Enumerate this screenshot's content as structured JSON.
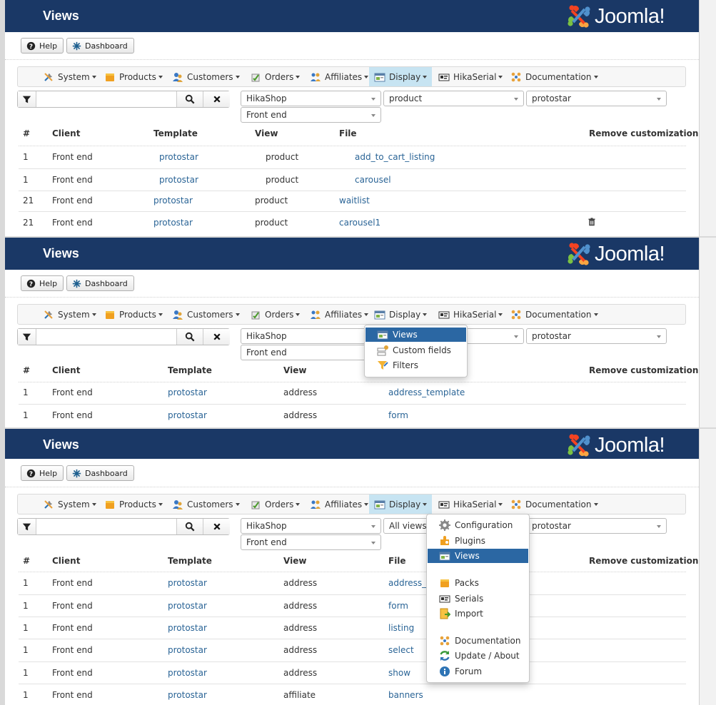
{
  "header": {
    "title": "Views",
    "logo_text": "Joomla!"
  },
  "toolbar": {
    "help_label": "Help",
    "dashboard_label": "Dashboard"
  },
  "menu": {
    "system": "System",
    "products": "Products",
    "customers": "Customers",
    "orders": "Orders",
    "affiliates": "Affiliates",
    "display": "Display",
    "hikaserial": "HikaSerial",
    "documentation": "Documentation"
  },
  "display_dropdown": {
    "views": "Views",
    "custom_fields": "Custom fields",
    "filters": "Filters"
  },
  "hikaserial_dropdown": {
    "configuration": "Configuration",
    "plugins": "Plugins",
    "views": "Views",
    "packs": "Packs",
    "serials": "Serials",
    "import": "Import",
    "documentation": "Documentation",
    "update_about": "Update / About",
    "forum": "Forum"
  },
  "table_headers": {
    "num": "#",
    "client": "Client",
    "template": "Template",
    "view": "View",
    "file": "File",
    "remove": "Remove customization"
  },
  "panel1": {
    "filters": {
      "component": "HikaShop",
      "view": "product",
      "template": "protostar",
      "client": "Front end"
    },
    "rows": [
      {
        "num": "1",
        "client": "Front end",
        "template": "protostar",
        "view": "product",
        "file": "add_to_cart_listing"
      },
      {
        "num": "1",
        "client": "Front end",
        "template": "protostar",
        "view": "product",
        "file": "carousel"
      },
      {
        "num": "21",
        "client": "Front end",
        "template": "protostar",
        "view": "product",
        "file": "waitlist"
      },
      {
        "num": "21",
        "client": "Front end",
        "template": "protostar",
        "view": "product",
        "file": "carousel1"
      }
    ]
  },
  "panel2": {
    "filters": {
      "component": "HikaShop",
      "template": "protostar",
      "client": "Front end"
    },
    "rows": [
      {
        "num": "1",
        "client": "Front end",
        "template": "protostar",
        "view": "address",
        "file": "address_template"
      },
      {
        "num": "1",
        "client": "Front end",
        "template": "protostar",
        "view": "address",
        "file": "form"
      }
    ]
  },
  "panel3": {
    "filters": {
      "component": "HikaShop",
      "view": "All views",
      "template": "protostar",
      "client": "Front end"
    },
    "rows": [
      {
        "num": "1",
        "client": "Front end",
        "template": "protostar",
        "view": "address",
        "file": "address_"
      },
      {
        "num": "1",
        "client": "Front end",
        "template": "protostar",
        "view": "address",
        "file": "form"
      },
      {
        "num": "1",
        "client": "Front end",
        "template": "protostar",
        "view": "address",
        "file": "listing"
      },
      {
        "num": "1",
        "client": "Front end",
        "template": "protostar",
        "view": "address",
        "file": "select"
      },
      {
        "num": "1",
        "client": "Front end",
        "template": "protostar",
        "view": "address",
        "file": "show"
      },
      {
        "num": "1",
        "client": "Front end",
        "template": "protostar",
        "view": "affiliate",
        "file": "banners"
      }
    ]
  },
  "colors": {
    "header_bg": "#1a3866",
    "active_menu": "#c7e4f2",
    "highlight": "#2b67a3",
    "link": "#2a6496"
  },
  "icons": {
    "system": "tools-icon",
    "products": "box-icon",
    "customers": "users-icon",
    "orders": "orders-icon",
    "affiliates": "affiliates-icon",
    "display": "display-icon",
    "hikaserial": "serial-icon",
    "documentation": "documentation-icon",
    "help": "question-icon",
    "dashboard": "dashboard-icon",
    "filter": "filter-icon",
    "search": "search-icon",
    "clear": "close-icon",
    "remove": "trash-icon"
  }
}
